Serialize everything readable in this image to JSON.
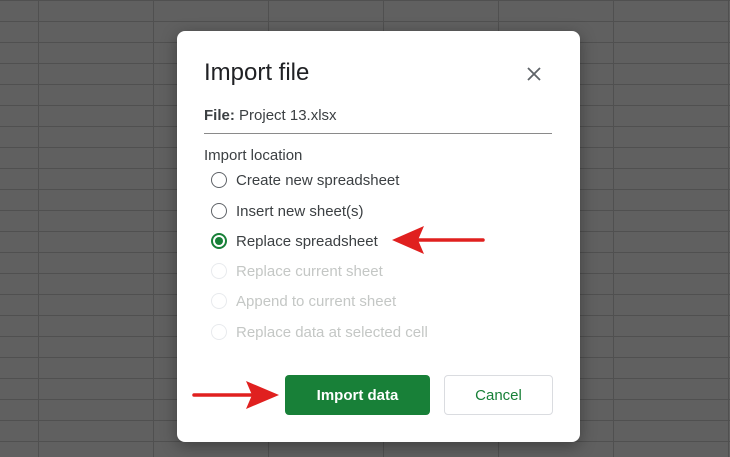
{
  "dialog": {
    "title": "Import file",
    "close_icon": "close-icon",
    "file_label": "File:",
    "file_name": "Project 13.xlsx",
    "section_label": "Import location",
    "options": [
      {
        "label": "Create new spreadsheet",
        "state": "unchecked"
      },
      {
        "label": "Insert new sheet(s)",
        "state": "unchecked"
      },
      {
        "label": "Replace spreadsheet",
        "state": "checked"
      },
      {
        "label": "Replace current sheet",
        "state": "disabled"
      },
      {
        "label": "Append to current sheet",
        "state": "disabled"
      },
      {
        "label": "Replace data at selected cell",
        "state": "disabled"
      }
    ],
    "primary_button": "Import data",
    "secondary_button": "Cancel"
  },
  "colors": {
    "accent": "#188038",
    "annotation_arrow": "#e0201f",
    "backdrop": "#606060"
  }
}
